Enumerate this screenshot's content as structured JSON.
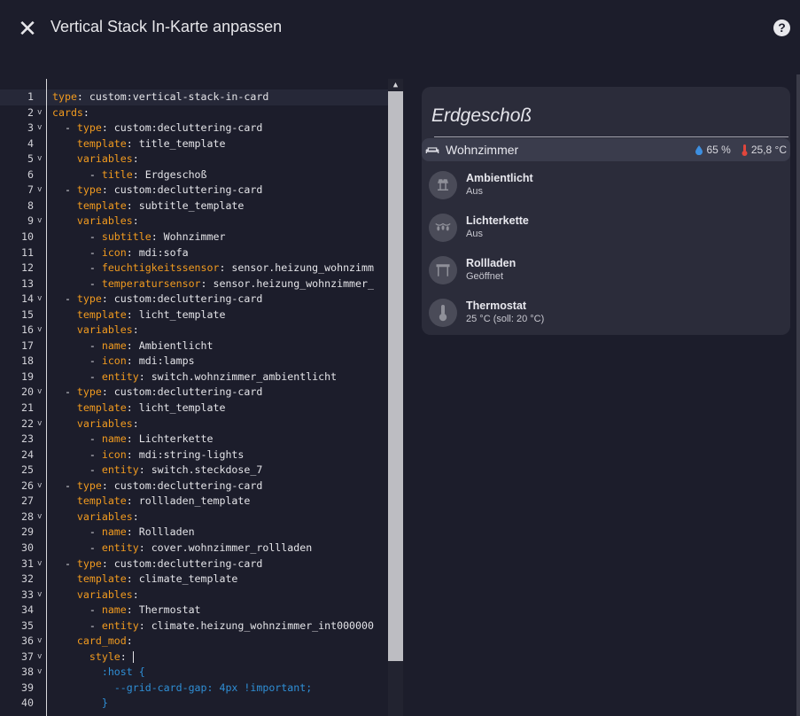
{
  "dialog": {
    "title": "Vertical Stack In-Karte anpassen",
    "close_icon": "close-icon",
    "help_icon": "help-circle-icon"
  },
  "editor": {
    "lines": [
      {
        "n": "1",
        "fold": false,
        "active": true,
        "segs": [
          [
            "k",
            "type"
          ],
          [
            "v",
            ": custom:vertical-stack-in-card"
          ]
        ]
      },
      {
        "n": "2",
        "fold": true,
        "segs": [
          [
            "k",
            "cards"
          ],
          [
            "v",
            ":"
          ]
        ]
      },
      {
        "n": "3",
        "fold": true,
        "segs": [
          [
            "v",
            "  - "
          ],
          [
            "k",
            "type"
          ],
          [
            "v",
            ": custom:decluttering-card"
          ]
        ]
      },
      {
        "n": "4",
        "fold": false,
        "segs": [
          [
            "v",
            "    "
          ],
          [
            "k",
            "template"
          ],
          [
            "v",
            ": title_template"
          ]
        ]
      },
      {
        "n": "5",
        "fold": true,
        "segs": [
          [
            "v",
            "    "
          ],
          [
            "k",
            "variables"
          ],
          [
            "v",
            ":"
          ]
        ]
      },
      {
        "n": "6",
        "fold": false,
        "segs": [
          [
            "v",
            "      - "
          ],
          [
            "k",
            "title"
          ],
          [
            "v",
            ": Erdgeschoß"
          ]
        ]
      },
      {
        "n": "7",
        "fold": true,
        "segs": [
          [
            "v",
            "  - "
          ],
          [
            "k",
            "type"
          ],
          [
            "v",
            ": custom:decluttering-card"
          ]
        ]
      },
      {
        "n": "8",
        "fold": false,
        "segs": [
          [
            "v",
            "    "
          ],
          [
            "k",
            "template"
          ],
          [
            "v",
            ": subtitle_template"
          ]
        ]
      },
      {
        "n": "9",
        "fold": true,
        "segs": [
          [
            "v",
            "    "
          ],
          [
            "k",
            "variables"
          ],
          [
            "v",
            ":"
          ]
        ]
      },
      {
        "n": "10",
        "fold": false,
        "segs": [
          [
            "v",
            "      - "
          ],
          [
            "k",
            "subtitle"
          ],
          [
            "v",
            ": Wohnzimmer"
          ]
        ]
      },
      {
        "n": "11",
        "fold": false,
        "segs": [
          [
            "v",
            "      - "
          ],
          [
            "k",
            "icon"
          ],
          [
            "v",
            ": mdi:sofa"
          ]
        ]
      },
      {
        "n": "12",
        "fold": false,
        "segs": [
          [
            "v",
            "      - "
          ],
          [
            "k",
            "feuchtigkeitssensor"
          ],
          [
            "v",
            ": sensor.heizung_wohnzimm"
          ]
        ]
      },
      {
        "n": "13",
        "fold": false,
        "segs": [
          [
            "v",
            "      - "
          ],
          [
            "k",
            "temperatursensor"
          ],
          [
            "v",
            ": sensor.heizung_wohnzimmer_"
          ]
        ]
      },
      {
        "n": "14",
        "fold": true,
        "segs": [
          [
            "v",
            "  - "
          ],
          [
            "k",
            "type"
          ],
          [
            "v",
            ": custom:decluttering-card"
          ]
        ]
      },
      {
        "n": "15",
        "fold": false,
        "segs": [
          [
            "v",
            "    "
          ],
          [
            "k",
            "template"
          ],
          [
            "v",
            ": licht_template"
          ]
        ]
      },
      {
        "n": "16",
        "fold": true,
        "segs": [
          [
            "v",
            "    "
          ],
          [
            "k",
            "variables"
          ],
          [
            "v",
            ":"
          ]
        ]
      },
      {
        "n": "17",
        "fold": false,
        "segs": [
          [
            "v",
            "      - "
          ],
          [
            "k",
            "name"
          ],
          [
            "v",
            ": Ambientlicht"
          ]
        ]
      },
      {
        "n": "18",
        "fold": false,
        "segs": [
          [
            "v",
            "      - "
          ],
          [
            "k",
            "icon"
          ],
          [
            "v",
            ": mdi:lamps"
          ]
        ]
      },
      {
        "n": "19",
        "fold": false,
        "segs": [
          [
            "v",
            "      - "
          ],
          [
            "k",
            "entity"
          ],
          [
            "v",
            ": switch.wohnzimmer_ambientlicht"
          ]
        ]
      },
      {
        "n": "20",
        "fold": true,
        "segs": [
          [
            "v",
            "  - "
          ],
          [
            "k",
            "type"
          ],
          [
            "v",
            ": custom:decluttering-card"
          ]
        ]
      },
      {
        "n": "21",
        "fold": false,
        "segs": [
          [
            "v",
            "    "
          ],
          [
            "k",
            "template"
          ],
          [
            "v",
            ": licht_template"
          ]
        ]
      },
      {
        "n": "22",
        "fold": true,
        "segs": [
          [
            "v",
            "    "
          ],
          [
            "k",
            "variables"
          ],
          [
            "v",
            ":"
          ]
        ]
      },
      {
        "n": "23",
        "fold": false,
        "segs": [
          [
            "v",
            "      - "
          ],
          [
            "k",
            "name"
          ],
          [
            "v",
            ": Lichterkette"
          ]
        ]
      },
      {
        "n": "24",
        "fold": false,
        "segs": [
          [
            "v",
            "      - "
          ],
          [
            "k",
            "icon"
          ],
          [
            "v",
            ": mdi:string-lights"
          ]
        ]
      },
      {
        "n": "25",
        "fold": false,
        "segs": [
          [
            "v",
            "      - "
          ],
          [
            "k",
            "entity"
          ],
          [
            "v",
            ": switch.steckdose_7"
          ]
        ]
      },
      {
        "n": "26",
        "fold": true,
        "segs": [
          [
            "v",
            "  - "
          ],
          [
            "k",
            "type"
          ],
          [
            "v",
            ": custom:decluttering-card"
          ]
        ]
      },
      {
        "n": "27",
        "fold": false,
        "segs": [
          [
            "v",
            "    "
          ],
          [
            "k",
            "template"
          ],
          [
            "v",
            ": rollladen_template"
          ]
        ]
      },
      {
        "n": "28",
        "fold": true,
        "segs": [
          [
            "v",
            "    "
          ],
          [
            "k",
            "variables"
          ],
          [
            "v",
            ":"
          ]
        ]
      },
      {
        "n": "29",
        "fold": false,
        "segs": [
          [
            "v",
            "      - "
          ],
          [
            "k",
            "name"
          ],
          [
            "v",
            ": Rollladen"
          ]
        ]
      },
      {
        "n": "30",
        "fold": false,
        "segs": [
          [
            "v",
            "      - "
          ],
          [
            "k",
            "entity"
          ],
          [
            "v",
            ": cover.wohnzimmer_rollladen"
          ]
        ]
      },
      {
        "n": "31",
        "fold": true,
        "segs": [
          [
            "v",
            "  - "
          ],
          [
            "k",
            "type"
          ],
          [
            "v",
            ": custom:decluttering-card"
          ]
        ]
      },
      {
        "n": "32",
        "fold": false,
        "segs": [
          [
            "v",
            "    "
          ],
          [
            "k",
            "template"
          ],
          [
            "v",
            ": climate_template"
          ]
        ]
      },
      {
        "n": "33",
        "fold": true,
        "segs": [
          [
            "v",
            "    "
          ],
          [
            "k",
            "variables"
          ],
          [
            "v",
            ":"
          ]
        ]
      },
      {
        "n": "34",
        "fold": false,
        "segs": [
          [
            "v",
            "      - "
          ],
          [
            "k",
            "name"
          ],
          [
            "v",
            ": Thermostat"
          ]
        ]
      },
      {
        "n": "35",
        "fold": false,
        "segs": [
          [
            "v",
            "      - "
          ],
          [
            "k",
            "entity"
          ],
          [
            "v",
            ": climate.heizung_wohnzimmer_int000000"
          ]
        ]
      },
      {
        "n": "36",
        "fold": true,
        "segs": [
          [
            "v",
            "    "
          ],
          [
            "k",
            "card_mod"
          ],
          [
            "v",
            ":"
          ]
        ]
      },
      {
        "n": "37",
        "fold": true,
        "caret": true,
        "segs": [
          [
            "v",
            "      "
          ],
          [
            "k",
            "style"
          ],
          [
            "v",
            ": "
          ]
        ]
      },
      {
        "n": "38",
        "fold": true,
        "segs": [
          [
            "v",
            "        "
          ],
          [
            "c",
            ":host {"
          ]
        ]
      },
      {
        "n": "39",
        "fold": false,
        "segs": [
          [
            "v",
            "          "
          ],
          [
            "c",
            "--grid-card-gap: 4px !important;"
          ]
        ]
      },
      {
        "n": "40",
        "fold": false,
        "segs": [
          [
            "v",
            "        "
          ],
          [
            "c",
            "}"
          ]
        ]
      }
    ]
  },
  "preview": {
    "title": "Erdgeschoß",
    "subtitle": {
      "label": "Wohnzimmer",
      "icon": "sofa-icon",
      "humidity": "65 %",
      "temperature": "25,8 °C"
    },
    "entities": [
      {
        "name": "Ambientlicht",
        "state": "Aus",
        "icon": "lamps-icon"
      },
      {
        "name": "Lichterkette",
        "state": "Aus",
        "icon": "string-lights-icon"
      },
      {
        "name": "Rollladen",
        "state": "Geöffnet",
        "icon": "window-shutter-open-icon"
      },
      {
        "name": "Thermostat",
        "state": "25 °C (soll: 20 °C)",
        "icon": "thermometer-icon"
      }
    ]
  },
  "colors": {
    "background": "#1c1d2b",
    "yaml_key": "#f29b1f",
    "yaml_css": "#2f8fd6",
    "card": "#2b2c3a",
    "humidity": "#3d8fe0",
    "temperature": "#e0463c"
  }
}
